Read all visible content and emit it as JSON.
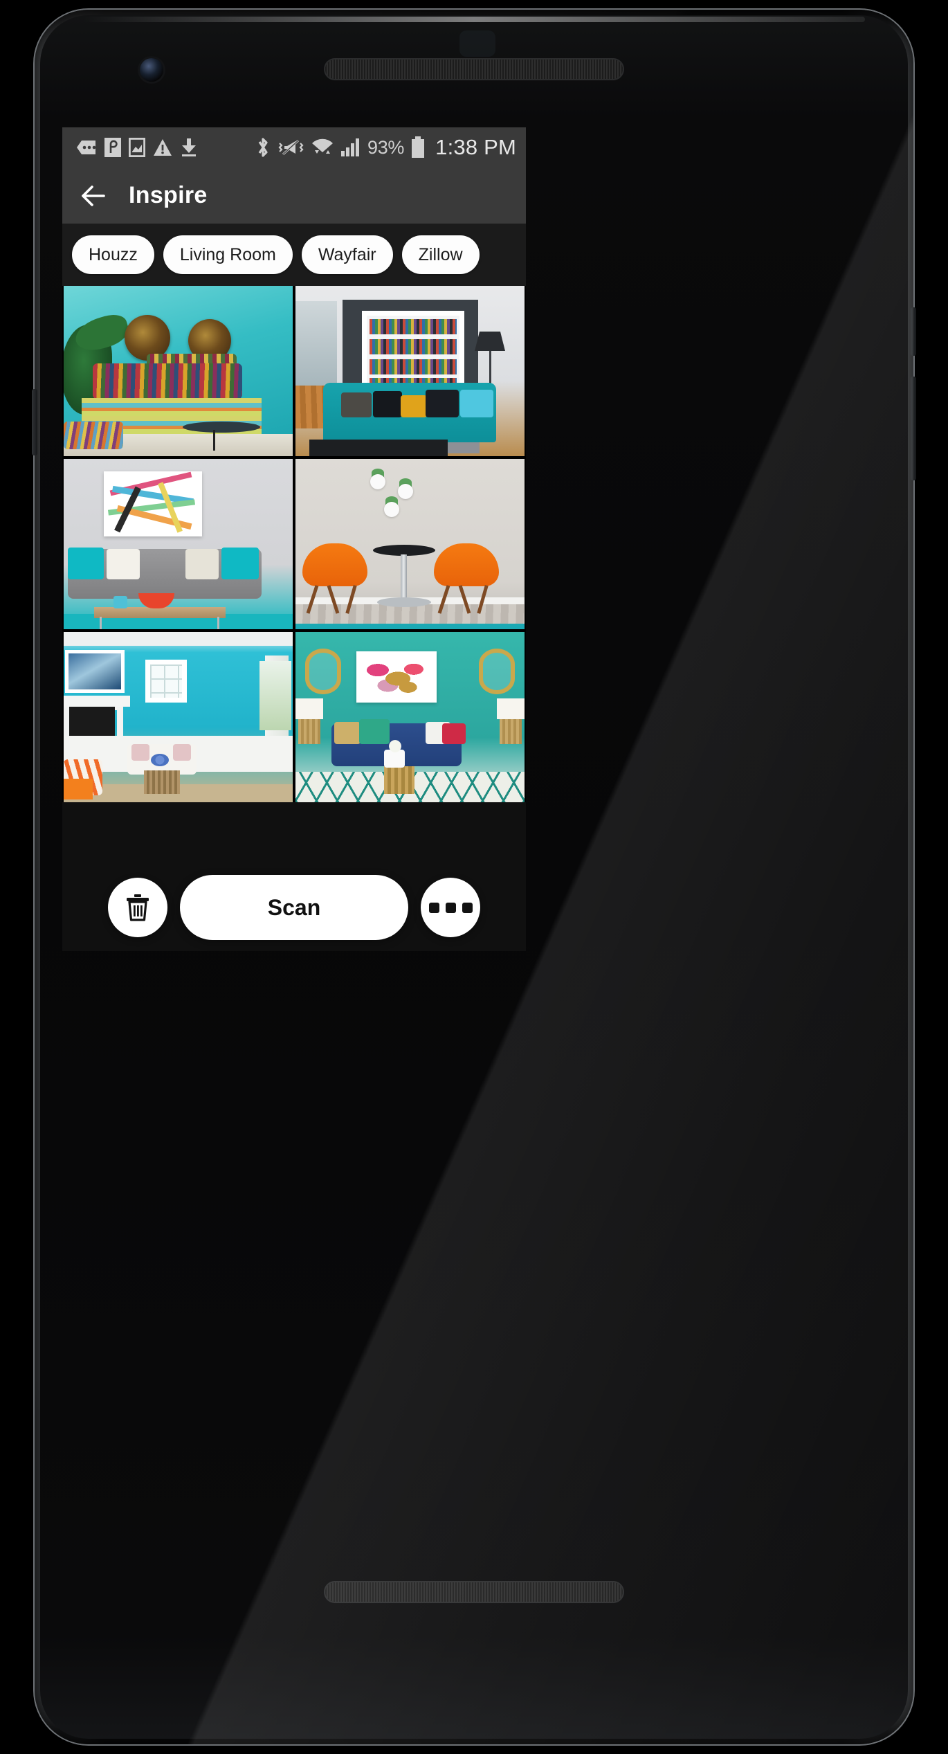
{
  "status_bar": {
    "icons_left": [
      "more-messages-icon",
      "app-notification-icon",
      "screenshot-icon",
      "warning-icon",
      "download-icon"
    ],
    "icons_right": [
      "bluetooth-icon",
      "vibrate-off-icon",
      "wifi-icon",
      "signal-icon"
    ],
    "battery_percent": "93%",
    "clock": "1:38 PM"
  },
  "app_bar": {
    "back_label": "back-arrow",
    "title": "Inspire"
  },
  "chips": [
    {
      "label": "Houzz"
    },
    {
      "label": "Living Room"
    },
    {
      "label": "Wayfair"
    },
    {
      "label": "Zillow"
    }
  ],
  "gallery": {
    "tiles": [
      {
        "alt": "Teal stucco wall with boho daybed, striped pillows and woven wall discs"
      },
      {
        "alt": "Modern living room with teal sectional sofa and slanted white bookshelf"
      },
      {
        "alt": "Grey tufted sofa with colorful abstract canvas and teal rug"
      },
      {
        "alt": "Two orange Eames armchairs flanking a round black pedestal table"
      },
      {
        "alt": "Turquoise coastal living room with white fireplace and wainscoting"
      },
      {
        "alt": "Teal glam living room with navy sofa, gold quatrefoil mirrors and pink art"
      }
    ]
  },
  "action_bar": {
    "delete_label": "trash-icon",
    "scan_label": "Scan",
    "more_label": "overflow-menu"
  },
  "colors": {
    "status_bar_bg": "#3a3a3a",
    "app_bar_bg": "#3a3a3a",
    "chip_bg": "#fdfdfd",
    "screen_bg": "#1b1b1b",
    "accent_teal": "#14b8bf"
  }
}
